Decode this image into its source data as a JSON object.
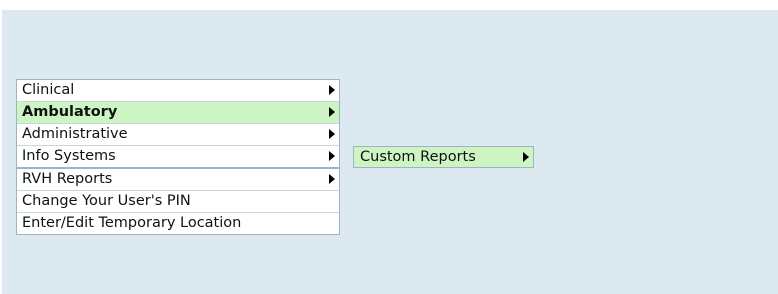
{
  "menu": {
    "items": [
      {
        "label": "Clinical",
        "has_submenu": true,
        "active": false
      },
      {
        "label": "Ambulatory",
        "has_submenu": true,
        "active": true
      },
      {
        "label": "Administrative",
        "has_submenu": true,
        "active": false
      },
      {
        "label": "Info Systems",
        "has_submenu": true,
        "active": false
      },
      {
        "label": "RVH Reports",
        "has_submenu": true,
        "active": false
      },
      {
        "label": "Change Your User's PIN",
        "has_submenu": false,
        "active": false
      },
      {
        "label": "Enter/Edit Temporary Location",
        "has_submenu": false,
        "active": false
      }
    ]
  },
  "submenu": {
    "items": [
      {
        "label": "Custom Reports",
        "has_submenu": true,
        "active": true
      }
    ]
  },
  "colors": {
    "background": "#dde9f0",
    "active_highlight": "#ccf5c3",
    "border": "#9fb4c2"
  }
}
